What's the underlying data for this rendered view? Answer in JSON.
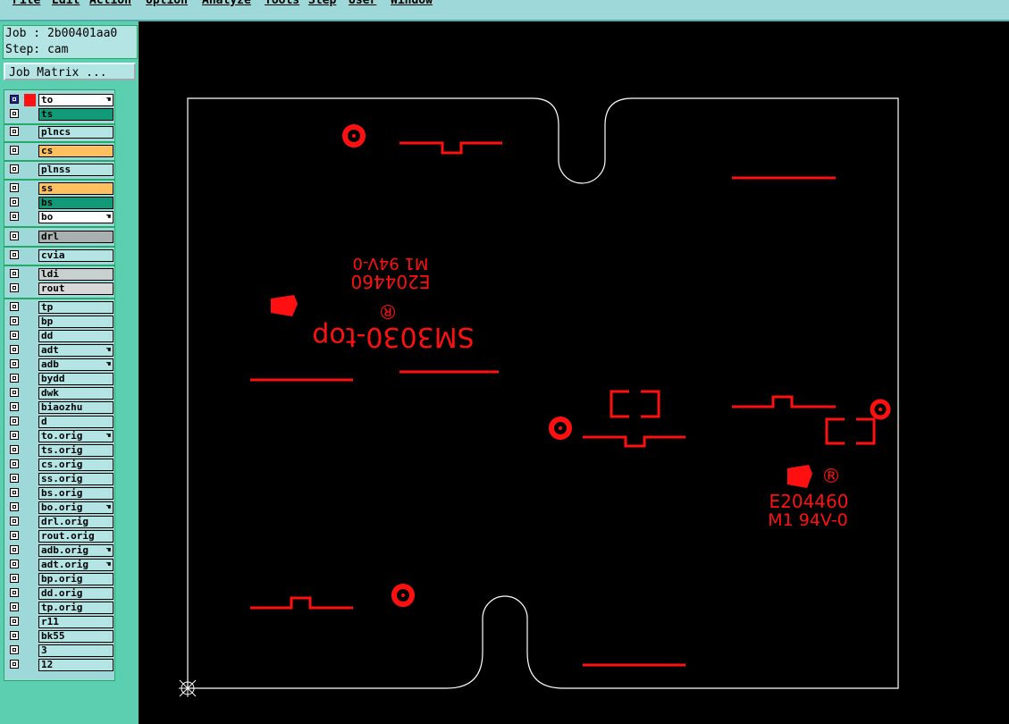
{
  "menu": [
    "File",
    "Edit",
    "Action",
    "Option",
    "Analyze",
    "Tools",
    "Step",
    "User",
    "Window"
  ],
  "job": {
    "job_line": "Job : 2b00401aa0",
    "step_line": "Step: cam"
  },
  "job_matrix_label": "Job Matrix ...",
  "layers": [
    {
      "name": "to",
      "color": "#ffffff",
      "hand": true,
      "selected": true
    },
    {
      "name": "ts",
      "color": "#129a78"
    },
    {
      "name": "plncs",
      "color": "#b4e4e4"
    },
    {
      "name": "cs",
      "color": "#ffc060"
    },
    {
      "name": "plnss",
      "color": "#b4e4e4"
    },
    {
      "name": "ss",
      "color": "#ffc060"
    },
    {
      "name": "bs",
      "color": "#129a78"
    },
    {
      "name": "bo",
      "color": "#ffffff",
      "hand": true
    },
    {
      "name": "drl",
      "color": "#a8b0b0"
    },
    {
      "name": "cvia",
      "color": "#b4e4e4"
    },
    {
      "name": "ldi",
      "color": "#c8d0d0"
    },
    {
      "name": "rout",
      "color": "#d8d8d8"
    },
    {
      "name": "tp",
      "color": "#b4e4e4"
    },
    {
      "name": "bp",
      "color": "#b4e4e4"
    },
    {
      "name": "dd",
      "color": "#b4e4e4"
    },
    {
      "name": "adt",
      "color": "#b4e4e4",
      "hand": true
    },
    {
      "name": "adb",
      "color": "#b4e4e4",
      "hand": true
    },
    {
      "name": "bydd",
      "color": "#b4e4e4"
    },
    {
      "name": "dwk",
      "color": "#b4e4e4"
    },
    {
      "name": "biaozhu",
      "color": "#b4e4e4"
    },
    {
      "name": "d",
      "color": "#b4e4e4"
    },
    {
      "name": "to.orig",
      "color": "#b4e4e4",
      "hand": true
    },
    {
      "name": "ts.orig",
      "color": "#b4e4e4"
    },
    {
      "name": "cs.orig",
      "color": "#b4e4e4"
    },
    {
      "name": "ss.orig",
      "color": "#b4e4e4"
    },
    {
      "name": "bs.orig",
      "color": "#b4e4e4"
    },
    {
      "name": "bo.orig",
      "color": "#b4e4e4",
      "hand": true
    },
    {
      "name": "drl.orig",
      "color": "#b4e4e4"
    },
    {
      "name": "rout.orig",
      "color": "#b4e4e4"
    },
    {
      "name": "adb.orig",
      "color": "#b4e4e4",
      "hand": true
    },
    {
      "name": "adt.orig",
      "color": "#b4e4e4",
      "hand": true
    },
    {
      "name": "bp.orig",
      "color": "#b4e4e4"
    },
    {
      "name": "dd.orig",
      "color": "#b4e4e4"
    },
    {
      "name": "tp.orig",
      "color": "#b4e4e4"
    },
    {
      "name": "r11",
      "color": "#b4e4e4"
    },
    {
      "name": "bk55",
      "color": "#b4e4e4"
    },
    {
      "name": "3",
      "color": "#b4e4e4"
    },
    {
      "name": "12",
      "color": "#b4e4e4"
    }
  ],
  "board_text": {
    "silk_top": "SM3030-top",
    "ul_code": "E204460",
    "ul_rating": "M1 94V-0",
    "registered": "®"
  },
  "colors": {
    "feature": "#ff1010",
    "outline": "#ffffff",
    "canvas": "#000000"
  }
}
